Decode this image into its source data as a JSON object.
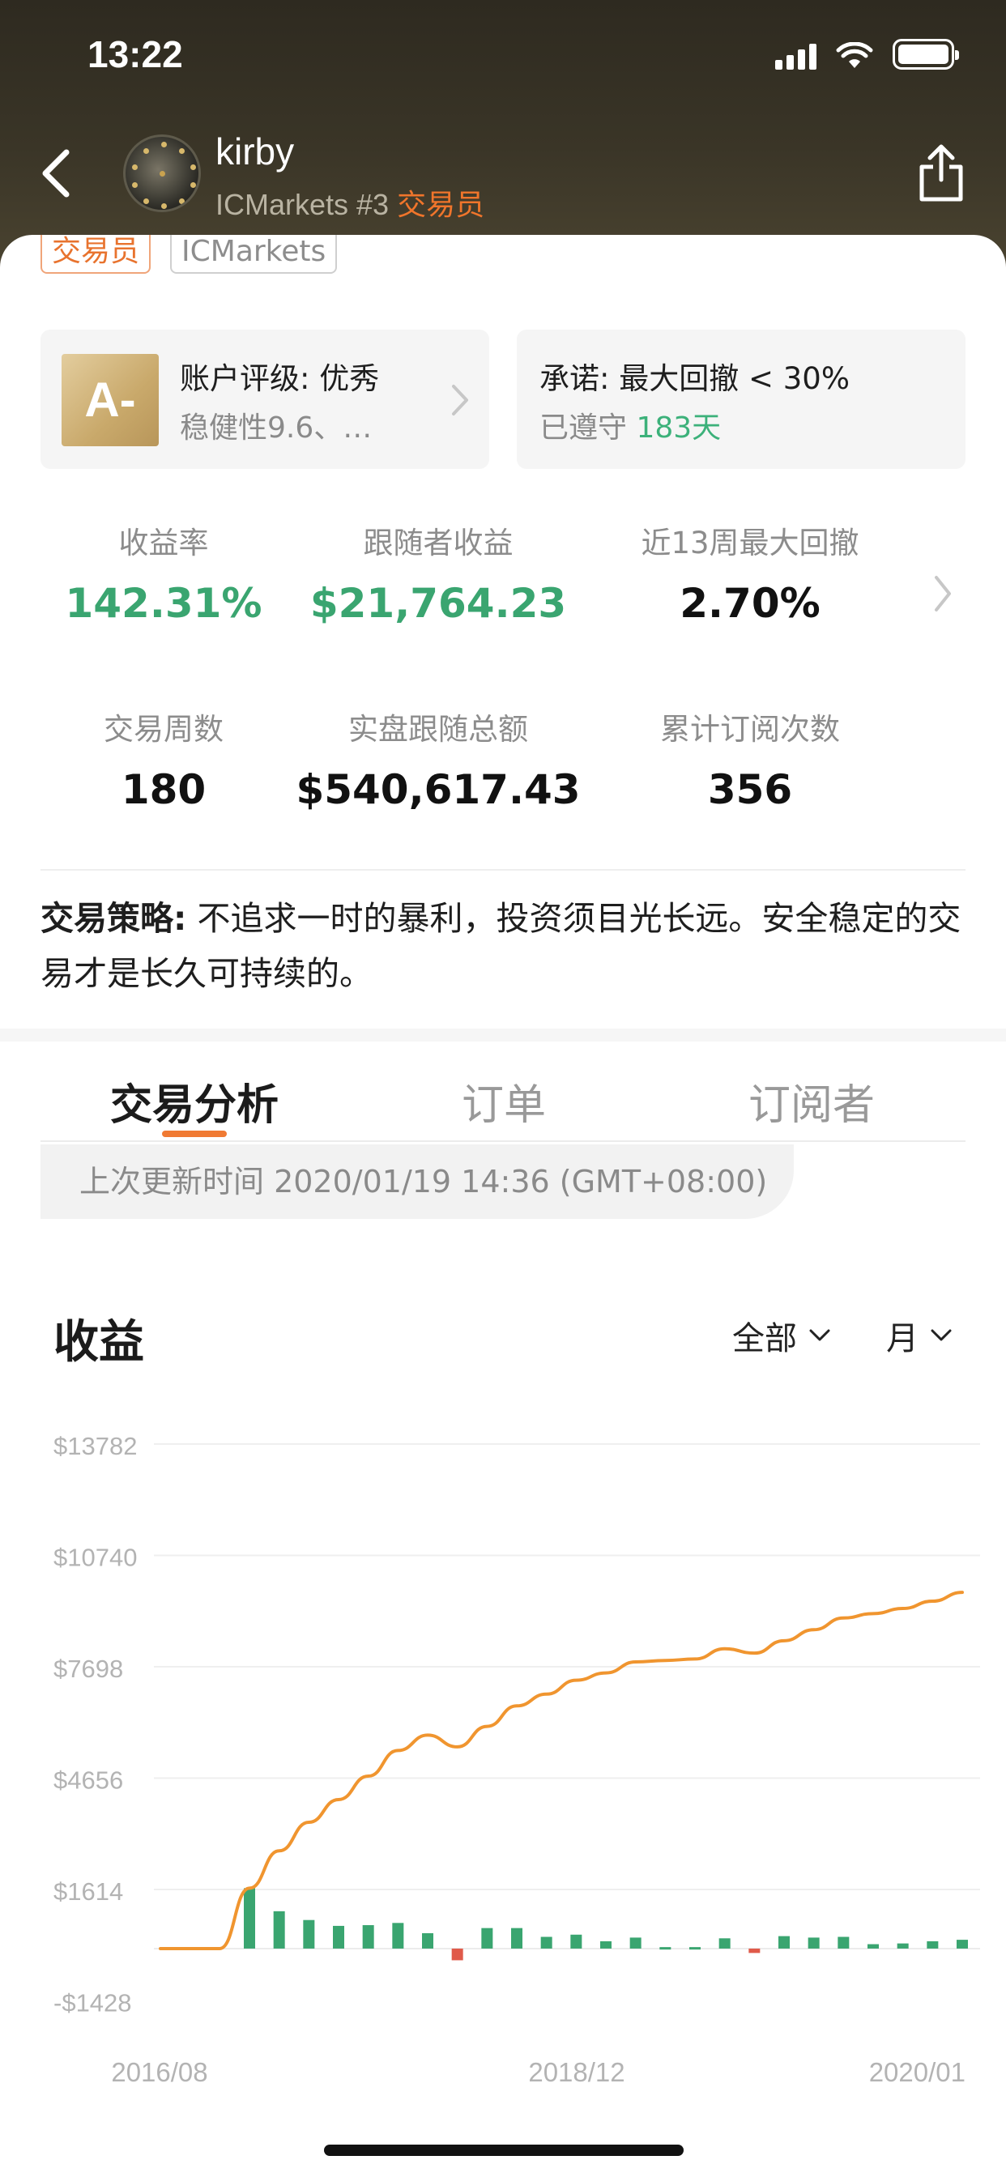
{
  "status_bar": {
    "time": "13:22"
  },
  "header": {
    "name": "kirby",
    "broker_rank": "ICMarkets #3",
    "role": "交易员"
  },
  "tags": {
    "role": "交易员",
    "broker": "ICMarkets"
  },
  "rating": {
    "grade": "A-",
    "title": "账户评级: 优秀",
    "subtitle": "稳健性9.6、…"
  },
  "promise": {
    "title": "承诺: 最大回撤 < 30%",
    "kept_prefix": "已遵守 ",
    "kept_days": "183天"
  },
  "stats": [
    {
      "label": "收益率",
      "value": "142.31%",
      "color": "#3aa570"
    },
    {
      "label": "跟随者收益",
      "value": "$21,764.23",
      "color": "#3aa570"
    },
    {
      "label": "近13周最大回撤",
      "value": "2.70%",
      "color": "#111111"
    },
    {
      "label": "交易周数",
      "value": "180",
      "color": "#111111"
    },
    {
      "label": "实盘跟随总额",
      "value": "$540,617.43",
      "color": "#111111"
    },
    {
      "label": "累计订阅次数",
      "value": "356",
      "color": "#111111"
    }
  ],
  "strategy": {
    "label": "交易策略:",
    "text": " 不追求一时的暴利，投资须目光长远。安全稳定的交易才是长久可持续的。"
  },
  "tabs": [
    {
      "label": "交易分析",
      "active": true
    },
    {
      "label": "订单",
      "active": false
    },
    {
      "label": "订阅者",
      "active": false
    }
  ],
  "update_text": "上次更新时间 2020/01/19 14:36 (GMT+08:00)",
  "section": {
    "title": "收益",
    "range_filter": "全部",
    "period_filter": "月"
  },
  "colors": {
    "accent": "#f07a33",
    "gain": "#3aa570",
    "loss": "#e05a4a",
    "line": "#f0952f"
  },
  "chart_data": {
    "type": "bar+line",
    "y_ticks": [
      "$13782",
      "$10740",
      "$7698",
      "$4656",
      "$1614",
      "-$1428"
    ],
    "y_tick_values": [
      13782,
      10740,
      7698,
      4656,
      1614,
      -1428
    ],
    "x_labels": [
      "2016/08",
      "2018/12",
      "2020/01"
    ],
    "monthly_bars": [
      0,
      0,
      0,
      1650,
      1020,
      780,
      620,
      640,
      700,
      420,
      -320,
      560,
      560,
      320,
      380,
      200,
      300,
      40,
      40,
      280,
      -120,
      340,
      300,
      320,
      120,
      140,
      200,
      240
    ],
    "cumulative_line": [
      0,
      0,
      0,
      1650,
      2670,
      3450,
      4070,
      4710,
      5410,
      5830,
      5510,
      6070,
      6630,
      6950,
      7330,
      7530,
      7830,
      7870,
      7910,
      8190,
      8070,
      8410,
      8710,
      9030,
      9150,
      9290,
      9490,
      9730
    ],
    "grid": true
  }
}
